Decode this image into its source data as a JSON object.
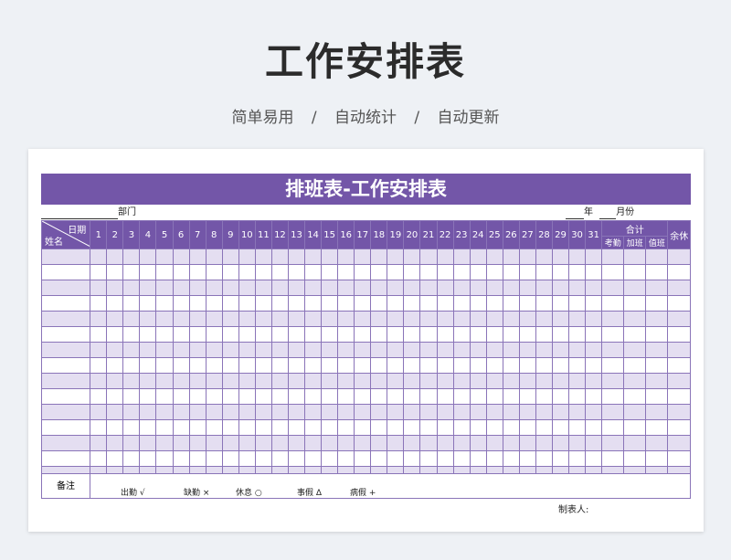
{
  "page": {
    "title": "工作安排表",
    "tagline": [
      "简单易用",
      "自动统计",
      "自动更新"
    ],
    "tagline_sep": "/"
  },
  "sheet": {
    "title": "排班表-工作安排表",
    "department_label": "部门",
    "year_label": "年",
    "month_label": "月份",
    "header": {
      "date_label": "日期",
      "name_label": "姓名",
      "days": [
        "1",
        "2",
        "3",
        "4",
        "5",
        "6",
        "7",
        "8",
        "9",
        "10",
        "11",
        "12",
        "13",
        "14",
        "15",
        "16",
        "17",
        "18",
        "19",
        "20",
        "21",
        "22",
        "23",
        "24",
        "25",
        "26",
        "27",
        "28",
        "29",
        "30",
        "31"
      ],
      "total_label": "合计",
      "total_sub": [
        "考勤",
        "加班",
        "值班"
      ],
      "rest_label": "余休"
    },
    "row_count": 15,
    "remarks_label": "备注",
    "legend": [
      {
        "label": "出勤",
        "symbol": "√"
      },
      {
        "label": "缺勤",
        "symbol": "×"
      },
      {
        "label": "休息",
        "symbol": "○"
      },
      {
        "label": "事假",
        "symbol": "Δ"
      },
      {
        "label": "病假",
        "symbol": "+"
      }
    ],
    "maker_label": "制表人:"
  },
  "colors": {
    "accent": "#7356a8",
    "row_band": "#e4def1",
    "grid_line": "#8a74b8"
  }
}
